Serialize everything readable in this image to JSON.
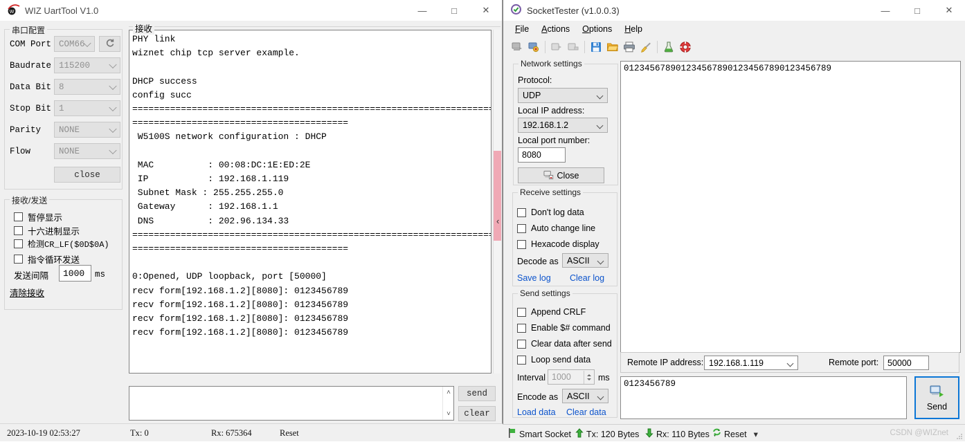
{
  "uart_window": {
    "title": "WIZ UartTool V1.0",
    "logo_icon": "wiz-logo-icon",
    "window_controls": [
      {
        "name": "minimize",
        "glyph": "—"
      },
      {
        "name": "maximize",
        "glyph": "□"
      },
      {
        "name": "close",
        "glyph": "✕"
      }
    ],
    "serial_group": {
      "legend": "串口配置",
      "fields": [
        {
          "label": "COM Port",
          "value": "COM66"
        },
        {
          "label": "Baudrate",
          "value": "115200"
        },
        {
          "label": "Data Bit",
          "value": "8"
        },
        {
          "label": "Stop Bit",
          "value": "1"
        },
        {
          "label": "Parity",
          "value": "NONE"
        },
        {
          "label": "Flow",
          "value": "NONE"
        }
      ],
      "refresh_icon": "refresh-icon",
      "close_button": "close"
    },
    "rxtx_group": {
      "legend": "接收/发送",
      "checkboxes": [
        {
          "label": "暂停显示",
          "checked": false
        },
        {
          "label": "十六进制显示",
          "checked": false
        },
        {
          "label": "检测CR_LF($0D$0A)",
          "checked": false
        },
        {
          "label": "指令循环发送",
          "checked": false
        }
      ],
      "interval_label": "发送间隔",
      "interval_value": "1000",
      "interval_unit": "ms",
      "clear_link": "清除接收"
    },
    "receive_group": {
      "legend": "接收",
      "log": "PHY link\nwiznet chip tcp server example.\n\nDHCP success\nconfig succ\n================================================================================\n========================================\n W5100S network configuration : DHCP\n\n MAC          : 00:08:DC:1E:ED:2E\n IP           : 192.168.1.119\n Subnet Mask : 255.255.255.0\n Gateway      : 192.168.1.1\n DNS          : 202.96.134.33\n================================================================================\n========================================\n\n0:Opened, UDP loopback, port [50000]\nrecv form[192.168.1.2][8080]: 0123456789\nrecv form[192.168.1.2][8080]: 0123456789\nrecv form[192.168.1.2][8080]: 0123456789\nrecv form[192.168.1.2][8080]: 0123456789"
    },
    "send_box": {
      "value": "",
      "scroll_up": "˄",
      "scroll_down": "˅"
    },
    "buttons": {
      "send": "send",
      "clear": "clear"
    },
    "status_bar": {
      "timestamp": "2023-10-19 02:53:27",
      "tx": "Tx: 0",
      "rx": "Rx: 675364",
      "reset": "Reset"
    },
    "splitter": {
      "collapse_icon": "chevron-left-icon",
      "thumb_color": "#f0a9b5"
    }
  },
  "socket_window": {
    "title": "SocketTester (v1.0.0.3)",
    "app_icon": "shield-check-icon",
    "window_controls": [
      {
        "name": "minimize",
        "glyph": "—"
      },
      {
        "name": "maximize",
        "glyph": "□"
      },
      {
        "name": "close",
        "glyph": "✕"
      }
    ],
    "menu": [
      {
        "label": "File",
        "accel": "F"
      },
      {
        "label": "Actions",
        "accel": "A"
      },
      {
        "label": "Options",
        "accel": "O"
      },
      {
        "label": "Help",
        "accel": "H"
      }
    ],
    "toolbar_icons": [
      "connect-icon",
      "disconnect-icon",
      "sep",
      "start-icon",
      "stop-icon",
      "sep",
      "save-icon",
      "open-folder-icon",
      "print-icon",
      "clear-broom-icon",
      "sep",
      "flask-icon",
      "lifebuoy-icon"
    ],
    "network_settings": {
      "legend": "Network settings",
      "protocol_label": "Protocol:",
      "protocol_value": "UDP",
      "local_ip_label": "Local IP address:",
      "local_ip_value": "192.168.1.2",
      "local_port_label": "Local port number:",
      "local_port_value": "8080",
      "close_button": "Close",
      "close_icon": "disconnect-icon"
    },
    "receive_settings": {
      "legend": "Receive settings",
      "checkboxes": [
        {
          "label": "Don't log data",
          "checked": false
        },
        {
          "label": "Auto change line",
          "checked": false
        },
        {
          "label": "Hexacode display",
          "checked": false
        }
      ],
      "decode_label": "Decode as",
      "decode_value": "ASCII",
      "save_log": "Save log",
      "clear_log": "Clear log"
    },
    "send_settings": {
      "legend": "Send settings",
      "checkboxes": [
        {
          "label": "Append CRLF",
          "checked": false
        },
        {
          "label": "Enable $# command",
          "checked": false
        },
        {
          "label": "Clear data after send",
          "checked": false
        },
        {
          "label": "Loop send data",
          "checked": false
        }
      ],
      "interval_label": "Interval",
      "interval_value": "1000",
      "interval_unit": "ms",
      "encode_label": "Encode as",
      "encode_value": "ASCII",
      "load_data": "Load data",
      "clear_data": "Clear data"
    },
    "log_text": "0123456789012345678901234567890123456789",
    "remote": {
      "ip_label": "Remote IP address:",
      "ip_value": "192.168.1.119",
      "port_label": "Remote port:",
      "port_value": "50000"
    },
    "send_data": "0123456789",
    "send_button": {
      "label": "Send",
      "icon": "send-icon"
    },
    "status_bar": {
      "smart_socket": "Smart Socket",
      "tx": "Tx: 120 Bytes",
      "rx": "Rx: 110 Bytes",
      "reset": "Reset",
      "dropdown_glyph": "▾",
      "watermark": "CSDN @WIZnet"
    }
  }
}
